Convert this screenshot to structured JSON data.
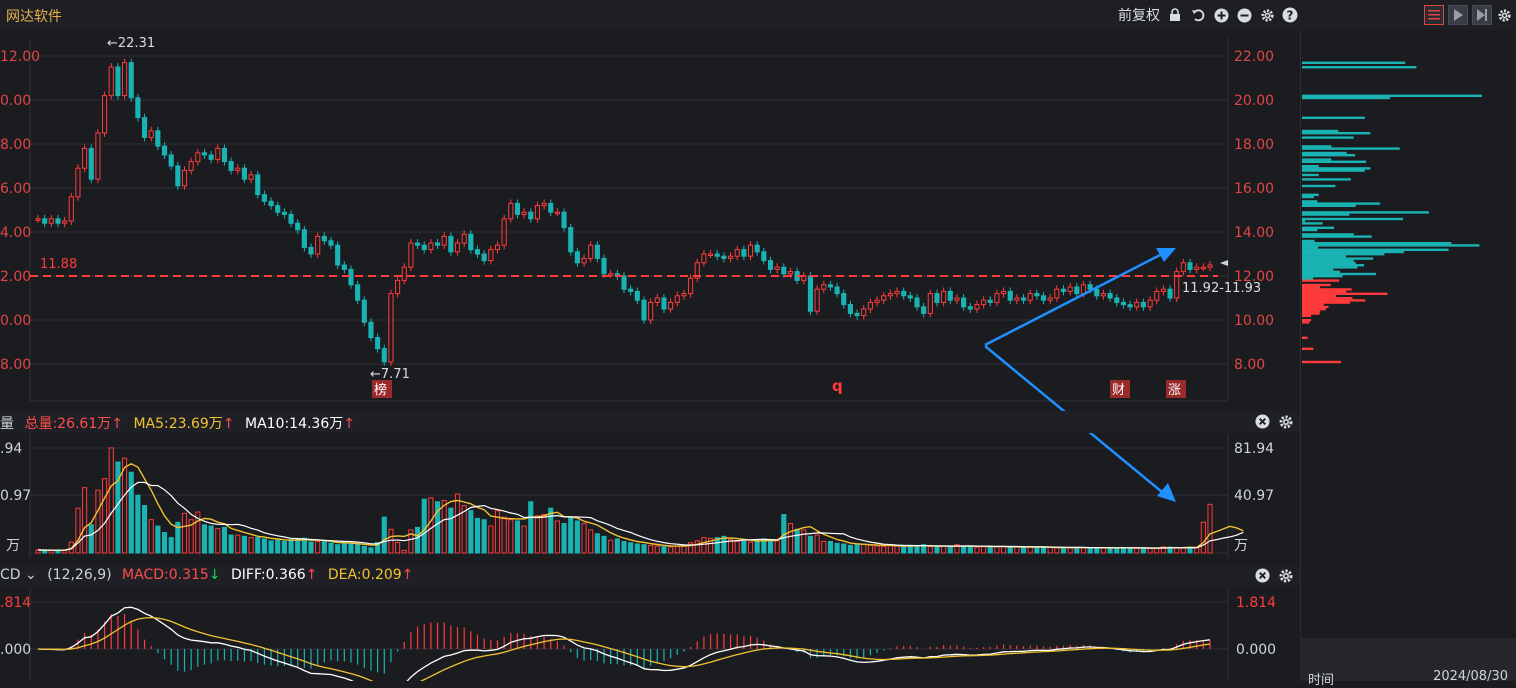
{
  "app": {
    "title": "网达软件",
    "adjust_label": "前复权"
  },
  "price_chart": {
    "y_ticks": [
      "22.00",
      "20.00",
      "18.00",
      "16.00",
      "14.00",
      "12.00",
      "10.00",
      "8.00"
    ],
    "left_ticks": [
      "12.00",
      "0.00",
      "8.00",
      "6.00",
      "4.00",
      "2.00",
      "0.00",
      "8.00"
    ],
    "high_label": "←22.31",
    "low_label": "←7.71",
    "ref_label": "11.88",
    "range_label": "11.92-11.93",
    "markers": {
      "bang": "榜",
      "q": "q",
      "cai": "财",
      "zhang": "涨"
    }
  },
  "volume_panel": {
    "title": "量",
    "total": "总量:26.61万",
    "ma5": "MA5:23.69万",
    "ma10": "MA10:14.36万",
    "ticks": [
      "81.94",
      "40.97",
      "万"
    ],
    "left_ticks": [
      ".94",
      "0.97",
      "万"
    ]
  },
  "macd_panel": {
    "title": "CD",
    "params": "(12,26,9)",
    "macd": "MACD:0.315",
    "diff": "DIFF:0.366",
    "dea": "DEA:0.209",
    "ticks": [
      "1.814",
      "0.000"
    ],
    "left_ticks": [
      ".814",
      ".000"
    ]
  },
  "footer": {
    "time_label": "时间",
    "date": "2024/08/30"
  },
  "colors": {
    "up": "#ff3b3b",
    "down": "#1ab3b3",
    "ref_line": "#ff3b3b",
    "arrow": "#1e90ff",
    "ma5": "#f2c230",
    "ma10": "#ffffff"
  },
  "chart_data": {
    "type": "candlestick",
    "ylim": [
      7.0,
      23.0
    ],
    "close": [
      14.6,
      14.4,
      14.6,
      14.4,
      14.5,
      15.6,
      16.9,
      17.8,
      16.4,
      18.5,
      20.2,
      21.5,
      20.2,
      21.7,
      20.1,
      19.2,
      18.3,
      18.6,
      17.9,
      17.5,
      17.0,
      16.1,
      16.8,
      17.2,
      17.6,
      17.5,
      17.3,
      17.8,
      17.2,
      16.8,
      16.9,
      16.4,
      16.6,
      15.7,
      15.4,
      15.2,
      14.9,
      14.8,
      14.4,
      14.1,
      13.3,
      13.0,
      13.8,
      13.6,
      13.4,
      12.5,
      12.3,
      11.6,
      10.9,
      9.9,
      9.2,
      8.7,
      8.1,
      11.2,
      11.8,
      12.4,
      13.5,
      13.4,
      13.2,
      13.5,
      13.4,
      13.8,
      13.1,
      13.5,
      13.9,
      13.2,
      13.0,
      12.7,
      13.2,
      13.4,
      14.6,
      15.3,
      14.8,
      14.9,
      14.6,
      15.2,
      15.3,
      14.9,
      14.9,
      14.2,
      13.1,
      12.6,
      12.8,
      13.4,
      12.8,
      12.1,
      12.1,
      12.0,
      11.4,
      11.3,
      10.9,
      10.0,
      10.8,
      11.0,
      10.5,
      10.8,
      11.1,
      11.2,
      11.9,
      12.6,
      13.0,
      13.0,
      12.9,
      12.8,
      12.9,
      13.2,
      12.9,
      13.4,
      13.1,
      12.7,
      12.3,
      12.4,
      12.1,
      12.2,
      11.8,
      12.0,
      10.4,
      11.4,
      11.6,
      11.5,
      11.2,
      10.7,
      10.3,
      10.2,
      10.5,
      10.8,
      10.9,
      11.1,
      11.2,
      11.3,
      11.1,
      11.0,
      10.6,
      10.3,
      11.2,
      10.8,
      11.3,
      10.9,
      11.0,
      10.6,
      10.5,
      10.7,
      10.9,
      10.8,
      11.2,
      11.3,
      10.9,
      11.0,
      10.9,
      11.2,
      11.1,
      10.9,
      11.0,
      11.4,
      11.3,
      11.5,
      11.2,
      11.6,
      11.4,
      11.1,
      11.2,
      11.0,
      10.8,
      10.7,
      10.6,
      10.8,
      10.6,
      10.9,
      11.3,
      11.4,
      11.0,
      12.2,
      12.6,
      12.3,
      12.4,
      12.4,
      12.5
    ],
    "volume": [
      2.4,
      2.1,
      2.0,
      2.2,
      2.3,
      8.5,
      35.0,
      51.0,
      22.0,
      49.0,
      58.0,
      82.0,
      71.0,
      74.0,
      63.0,
      45.0,
      37.0,
      26.0,
      21.0,
      16.0,
      12.0,
      24.0,
      31.0,
      26.0,
      32.0,
      22.0,
      21.0,
      19.0,
      20.0,
      14.0,
      14.0,
      13.0,
      12.0,
      12.0,
      11.0,
      9.5,
      10.0,
      9.0,
      10.5,
      11.0,
      11.5,
      8.6,
      9.0,
      9.0,
      7.6,
      6.5,
      8.0,
      7.5,
      6.6,
      5.2,
      4.0,
      8.2,
      28.0,
      18.5,
      8.2,
      2.0,
      18.0,
      20.0,
      42.0,
      43.0,
      40.0,
      41.0,
      35.0,
      46.0,
      37.0,
      33.0,
      27.0,
      26.0,
      21.0,
      33.0,
      28.0,
      26.0,
      25.0,
      21.0,
      40.0,
      29.0,
      30.0,
      35.0,
      25.0,
      23.0,
      28.0,
      25.0,
      23.0,
      18.0,
      15.0,
      13.0,
      10.0,
      11.0,
      9.0,
      8.0,
      7.0,
      6.5,
      6.0,
      5.5,
      5.0,
      4.8,
      5.5,
      6.0,
      8.0,
      9.5,
      12.0,
      11.5,
      12.0,
      13.0,
      10.5,
      9.0,
      9.0,
      8.5,
      10.0,
      11.0,
      10.0,
      9.5,
      30.0,
      23.0,
      18.5,
      18.0,
      13.0,
      14.0,
      9.0,
      9.0,
      7.5,
      7.0,
      6.0,
      6.5,
      7.0,
      6.0,
      5.5,
      5.0,
      6.0,
      5.5,
      5.0,
      6.0,
      5.5,
      6.5,
      5.0,
      4.5,
      5.5,
      5.0,
      6.5,
      5.5,
      5.0,
      4.5,
      5.0,
      5.5,
      4.8,
      5.0,
      4.0,
      5.0,
      4.8,
      5.0,
      4.5,
      4.0,
      4.5,
      4.0,
      4.2,
      4.0,
      4.5,
      4.0,
      3.8,
      4.2,
      3.9,
      4.0,
      4.1,
      4.2,
      4.0,
      3.6,
      4.0,
      3.5,
      3.5,
      4.8,
      4.6,
      4.2,
      4.0,
      4.5,
      4.2,
      24.0,
      38.0,
      13.0,
      15.0,
      14.0,
      18.0,
      26.61
    ],
    "volume_ylim": [
      0,
      81.94
    ],
    "macd_ylim": [
      -0.5,
      1.814
    ],
    "annotations": {
      "high": 22.31,
      "low": 7.71,
      "ref_line": 11.88
    }
  }
}
